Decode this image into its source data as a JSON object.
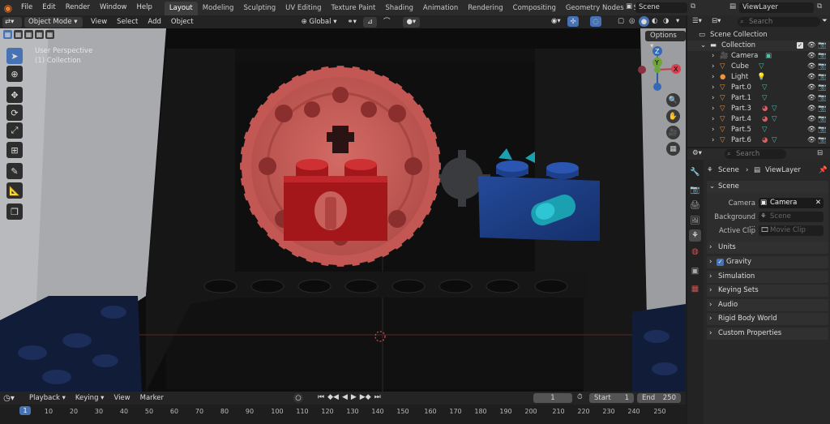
{
  "menus": [
    "File",
    "Edit",
    "Render",
    "Window",
    "Help"
  ],
  "workspaces": [
    "Layout",
    "Modeling",
    "Sculpting",
    "UV Editing",
    "Texture Paint",
    "Shading",
    "Animation",
    "Rendering",
    "Compositing",
    "Geometry Nodes",
    "Scripting"
  ],
  "scene_name": "Scene",
  "viewlayer_name": "ViewLayer",
  "viewport": {
    "mode": "Object Mode",
    "menus": [
      "View",
      "Select",
      "Add",
      "Object"
    ],
    "orientation": "Global",
    "options": "Options",
    "perspective": "User Perspective",
    "collection_info": "(1) Collection",
    "gizmo": {
      "z": "Z",
      "y": "Y",
      "x": "X"
    }
  },
  "outliner": {
    "search_placeholder": "Search",
    "root": "Scene Collection",
    "collection": "Collection",
    "items": [
      "Camera",
      "Cube",
      "Light",
      "Part.0",
      "Part.1",
      "Part.3",
      "Part.4",
      "Part.5",
      "Part.6"
    ]
  },
  "properties": {
    "search_placeholder": "Search",
    "breadcrumb_scene": "Scene",
    "breadcrumb_viewlayer": "ViewLayer",
    "scene_panel": "Scene",
    "camera_label": "Camera",
    "camera_value": "Camera",
    "background_label": "Background ...",
    "background_placeholder": "Scene",
    "active_clip_label": "Active Clip",
    "active_clip_placeholder": "Movie Clip",
    "panels": [
      "Units",
      "Gravity",
      "Simulation",
      "Keying Sets",
      "Audio",
      "Rigid Body World",
      "Custom Properties"
    ]
  },
  "timeline": {
    "menus": [
      "Playback",
      "Keying",
      "View",
      "Marker"
    ],
    "current_frame": "1",
    "start_label": "Start",
    "start": "1",
    "end_label": "End",
    "end": "250",
    "ruler": [
      "1",
      "10",
      "20",
      "30",
      "40",
      "50",
      "60",
      "70",
      "80",
      "90",
      "100",
      "110",
      "120",
      "130",
      "140",
      "150",
      "160",
      "170",
      "180",
      "190",
      "200",
      "210",
      "220",
      "230",
      "240",
      "250"
    ]
  },
  "colors": {
    "accent": "#4772b3",
    "red_gear": "#c45a55",
    "red_brick": "#a3161a",
    "blue_brick": "#1d3f8a",
    "teal": "#1aa0b0"
  }
}
